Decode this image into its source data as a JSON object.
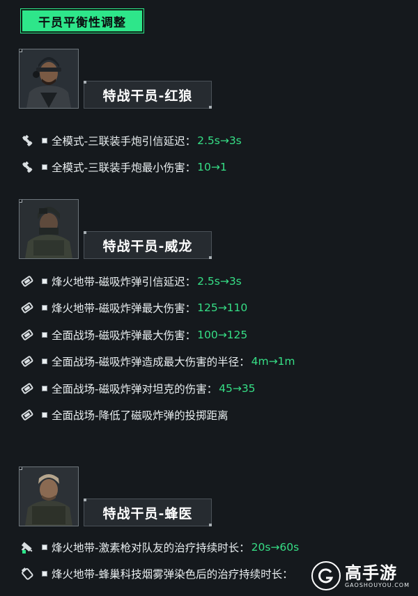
{
  "header": {
    "title": "干员平衡性调整"
  },
  "sections": [
    {
      "name": "特战干员-红狼",
      "items": [
        {
          "icon": "rocket-pod-icon",
          "text": "全模式-三联装手炮引信延迟：",
          "value": "2.5s→3s"
        },
        {
          "icon": "rocket-pod-icon",
          "text": "全模式-三联装手炮最小伤害：",
          "value": "10→1"
        }
      ]
    },
    {
      "name": "特战干员-威龙",
      "items": [
        {
          "icon": "magnetic-bomb-icon",
          "text": "烽火地带-磁吸炸弹引信延迟：",
          "value": "2.5s→3s"
        },
        {
          "icon": "magnetic-bomb-icon",
          "text": "烽火地带-磁吸炸弹最大伤害：",
          "value": "125→110"
        },
        {
          "icon": "magnetic-bomb-icon",
          "text": "全面战场-磁吸炸弹最大伤害：",
          "value": "100→125"
        },
        {
          "icon": "magnetic-bomb-icon",
          "text": "全面战场-磁吸炸弹造成最大伤害的半径：",
          "value": "4m→1m"
        },
        {
          "icon": "magnetic-bomb-icon",
          "text": "全面战场-磁吸炸弹对坦克的伤害：",
          "value": "45→35"
        },
        {
          "icon": "magnetic-bomb-icon",
          "text": "全面战场-降低了磁吸炸弹的投掷距离",
          "value": ""
        }
      ]
    },
    {
      "name": "特战干员-蜂医",
      "items": [
        {
          "icon": "stim-gun-icon",
          "text": "烽火地带-激素枪对队友的治疗持续时长：",
          "value": "20s→60s"
        },
        {
          "icon": "smoke-grenade-icon",
          "text": "烽火地带-蜂巢科技烟雾弹染色后的治疗持续时长：",
          "value": ""
        }
      ]
    }
  ],
  "watermark": {
    "name": "高手游",
    "site": "GAOSHOUYOU.COM"
  },
  "colors": {
    "accent": "#2ee68a",
    "value": "#36df86",
    "background": "#15191d"
  }
}
